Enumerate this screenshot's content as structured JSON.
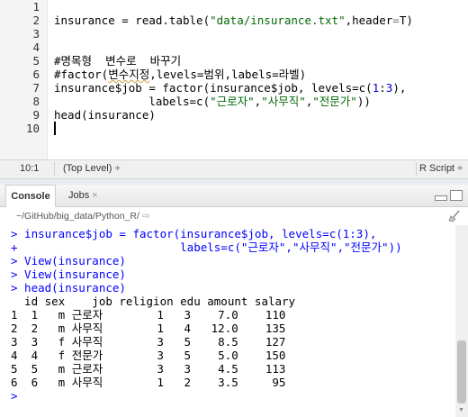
{
  "editor": {
    "line_numbers": [
      "1",
      "2",
      "3",
      "4",
      "5",
      "6",
      "7",
      "8",
      "9",
      "10"
    ],
    "lines": {
      "l2": {
        "a": "insurance = read.table(",
        "b": "\"data/insurance.txt\"",
        "c": ",header",
        "d": "=",
        "e": "T)"
      },
      "l5": {
        "a": "#명목형  변수로  바꾸기"
      },
      "l6": {
        "a": "#factor(",
        "b": "변수지정",
        "c": ",levels=범위,labels=라벨)"
      },
      "l7": {
        "a": "insurance$job = factor(insurance$job, levels=c(",
        "b": "1",
        "c": ":",
        "d": "3",
        "e": "),"
      },
      "l8": {
        "a": "              labels=c(",
        "b": "\"근로자\"",
        "c": ",",
        "d": "\"사무직\"",
        "e": ",",
        "f": "\"전문가\"",
        "g": "))"
      },
      "l9": {
        "a": "head(insurance)"
      }
    }
  },
  "status": {
    "position": "10:1",
    "scope": "(Top Level) ÷",
    "language": "R Script ÷"
  },
  "console_pane": {
    "tab_console": "Console",
    "tab_jobs": "Jobs",
    "tab_jobs_close": "×",
    "path": "~/GitHub/big_data/Python_R/",
    "lines": [
      "> insurance$job = factor(insurance$job, levels=c(1:3),",
      "+                        labels=c(\"근로자\",\"사무직\",\"전문가\"))",
      "> View(insurance)",
      "> View(insurance)",
      "> head(insurance)",
      "  id sex    job religion edu amount salary",
      "1  1   m 근로자        1   3    7.0    110",
      "2  2   m 사무직        1   4   12.0    135",
      "3  3   f 사무직        3   5    8.5    127",
      "4  4   f 전문가        3   5    5.0    150",
      "5  5   m 근로자        3   3    4.5    113",
      "6  6   m 사무직        1   2    3.5     95",
      ">"
    ]
  }
}
